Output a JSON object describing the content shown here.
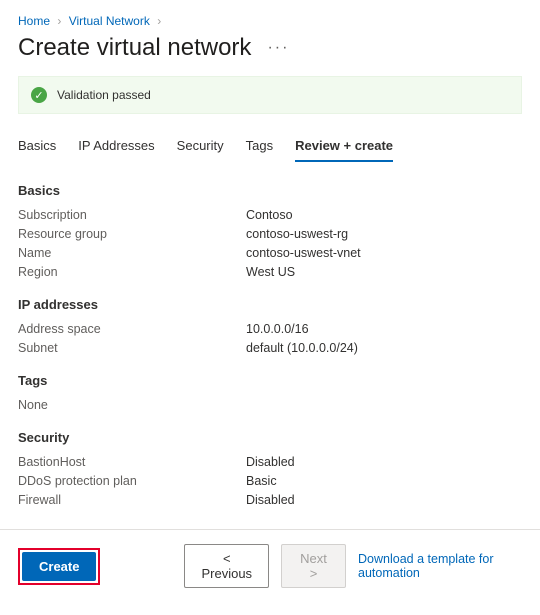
{
  "breadcrumb": {
    "home": "Home",
    "vnet": "Virtual Network"
  },
  "title": "Create virtual network",
  "validation_text": "Validation passed",
  "tabs": {
    "basics": "Basics",
    "ip": "IP Addresses",
    "security": "Security",
    "tags": "Tags",
    "review": "Review + create"
  },
  "sections": {
    "basics": {
      "heading": "Basics",
      "subscription_k": "Subscription",
      "subscription_v": "Contoso",
      "rg_k": "Resource group",
      "rg_v": "contoso-uswest-rg",
      "name_k": "Name",
      "name_v": "contoso-uswest-vnet",
      "region_k": "Region",
      "region_v": "West US"
    },
    "ip": {
      "heading": "IP addresses",
      "space_k": "Address space",
      "space_v": "10.0.0.0/16",
      "subnet_k": "Subnet",
      "subnet_v": "default (10.0.0.0/24)"
    },
    "tags": {
      "heading": "Tags",
      "none": "None"
    },
    "security": {
      "heading": "Security",
      "bastion_k": "BastionHost",
      "bastion_v": "Disabled",
      "ddos_k": "DDoS protection plan",
      "ddos_v": "Basic",
      "firewall_k": "Firewall",
      "firewall_v": "Disabled"
    }
  },
  "footer": {
    "create": "Create",
    "previous": "<  Previous",
    "next": "Next  >",
    "download": "Download a template for automation"
  }
}
